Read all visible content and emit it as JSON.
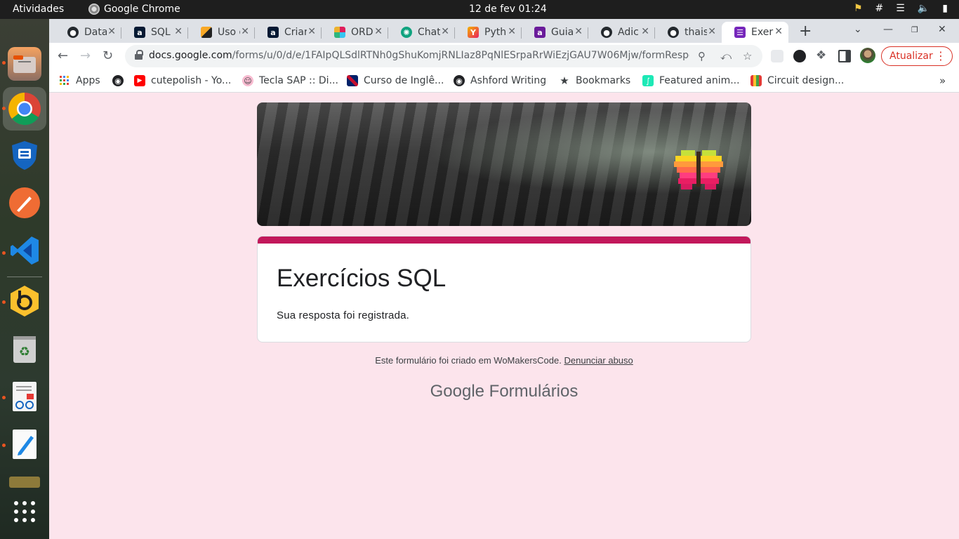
{
  "system": {
    "activities": "Atividades",
    "app_name": "Google Chrome",
    "clock": "12 de fev  01:24"
  },
  "tabs": [
    {
      "title": "Data",
      "icon": "github-icon"
    },
    {
      "title": "SQL",
      "icon": "alura-icon"
    },
    {
      "title": "Uso d",
      "icon": "generic-site-icon"
    },
    {
      "title": "Criar",
      "icon": "alura-icon"
    },
    {
      "title": "ORD",
      "icon": "slack-icon"
    },
    {
      "title": "Chat",
      "icon": "chatgpt-icon"
    },
    {
      "title": "Pyth",
      "icon": "ycombinator-icon"
    },
    {
      "title": "Guia",
      "icon": "alura-purple-icon"
    },
    {
      "title": "Adic",
      "icon": "github-icon"
    },
    {
      "title": "thais",
      "icon": "github-icon"
    },
    {
      "title": "Exer",
      "icon": "google-forms-icon",
      "active": true
    }
  ],
  "address": {
    "host": "docs.google.com",
    "path": "/forms/u/0/d/e/1FAIpQLSdlRTNh0gShuKomjRNLIaz8PqNlESrpaRrWiEzjGAU7W06Mjw/formResponse?pl..."
  },
  "update_button": "Atualizar",
  "bookmarks": [
    {
      "label": "Apps",
      "icon": "apps-grid-icon"
    },
    {
      "label": "",
      "icon": "globe-icon"
    },
    {
      "label": "cutepolish - Yo...",
      "icon": "youtube-icon"
    },
    {
      "label": "Tecla SAP :: Di...",
      "icon": "tecla-sap-icon"
    },
    {
      "label": "Curso de Inglê...",
      "icon": "uk-flag-icon"
    },
    {
      "label": "Ashford Writing",
      "icon": "globe-icon"
    },
    {
      "label": "Bookmarks",
      "icon": "star-icon"
    },
    {
      "label": "Featured anim...",
      "icon": "featured-anim-icon"
    },
    {
      "label": "Circuit design...",
      "icon": "circuit-icon"
    }
  ],
  "form": {
    "title": "Exercícios SQL",
    "confirmation": "Sua resposta foi registrada.",
    "footer_text": "Este formulário foi criado em WoMakersCode.",
    "footer_link": "Denunciar abuso",
    "brand_google": "Google",
    "brand_product": "Formulários"
  },
  "colors": {
    "page_background": "#fce4ec",
    "form_accent": "#c2185b",
    "update_red": "#d93025"
  }
}
